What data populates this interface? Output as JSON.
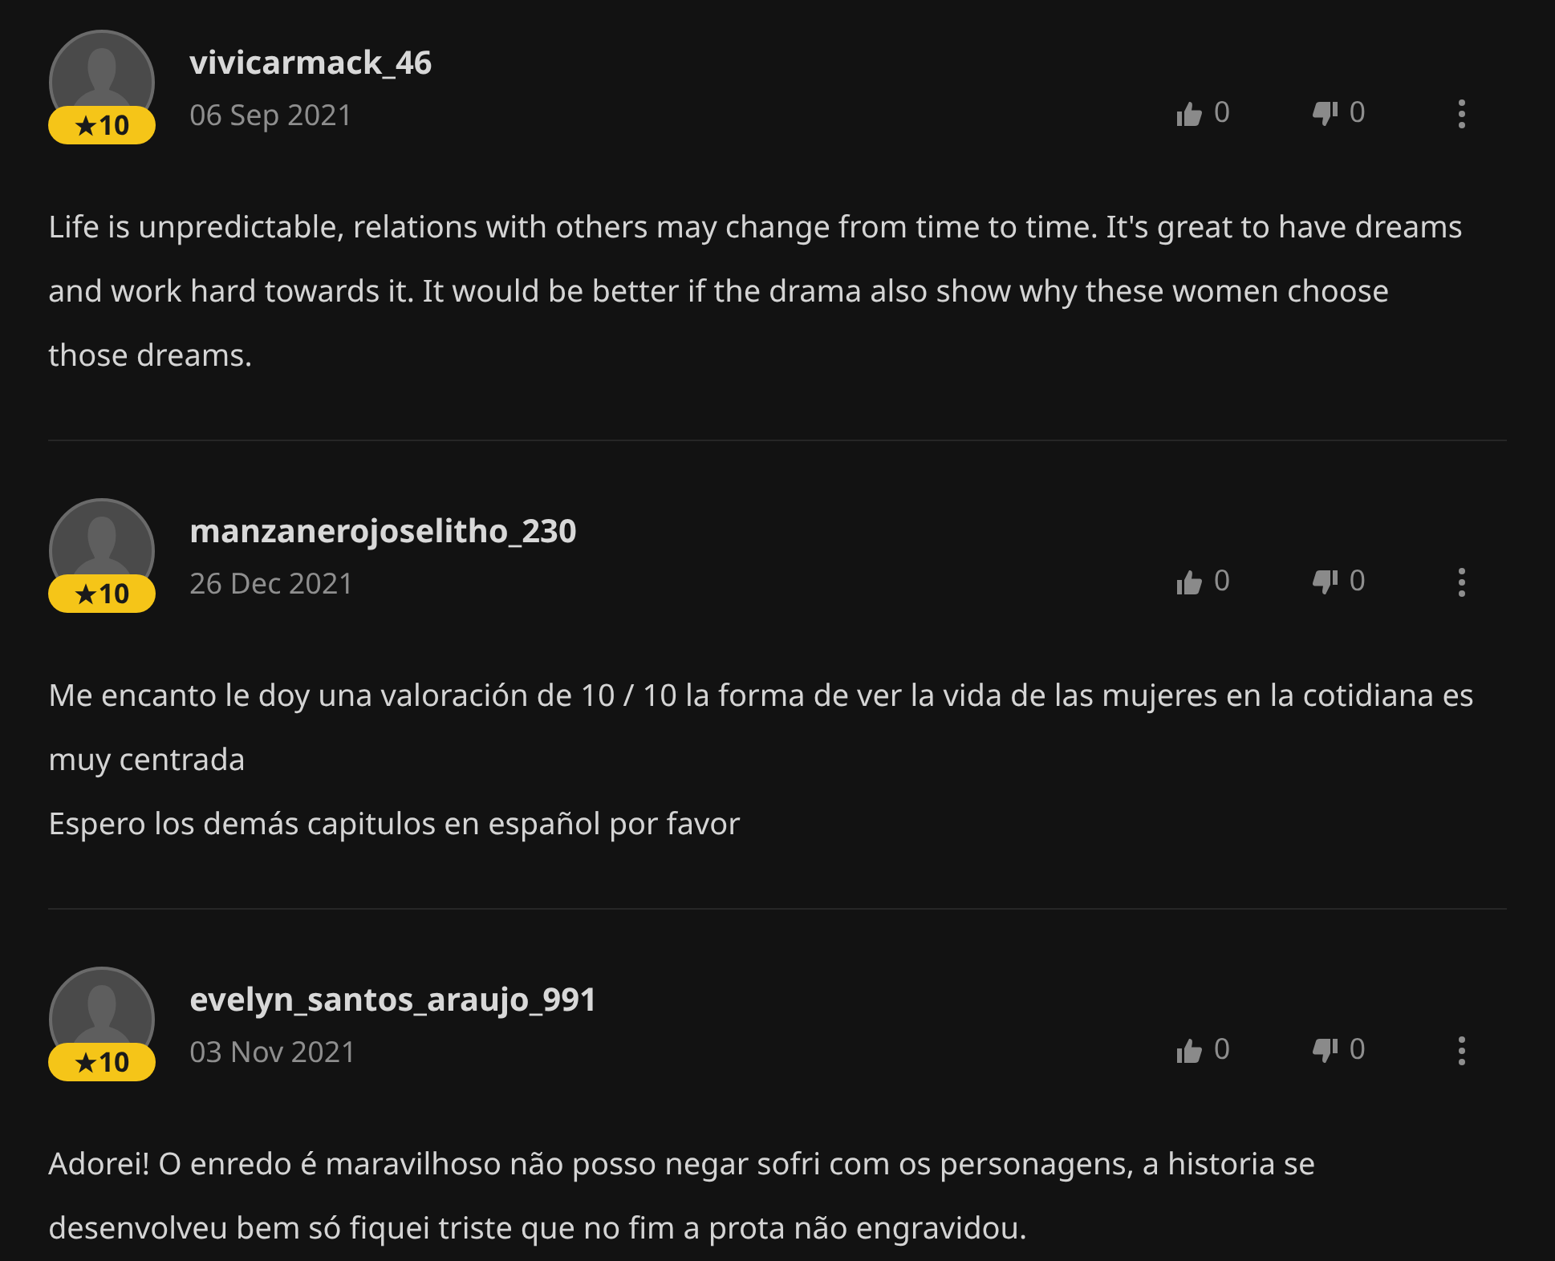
{
  "reviews": [
    {
      "username": "vivicarmack_46",
      "date": "06 Sep 2021",
      "rating": "10",
      "likes": "0",
      "dislikes": "0",
      "paragraphs": [
        "Life is unpredictable, relations with others may change from time to time. It's great to have dreams and work hard towards it. It would be better if the drama also show why these women choose those dreams."
      ]
    },
    {
      "username": "manzanerojoselitho_230",
      "date": "26 Dec 2021",
      "rating": "10",
      "likes": "0",
      "dislikes": "0",
      "paragraphs": [
        "Me encanto le doy una valoración de 10 / 10 la forma de ver la vida de las mujeres en la cotidiana es muy centrada",
        "Espero los demás capitulos en español por favor"
      ]
    },
    {
      "username": "evelyn_santos_araujo_991",
      "date": "03 Nov 2021",
      "rating": "10",
      "likes": "0",
      "dislikes": "0",
      "paragraphs": [
        "Adorei! O enredo é maravilhoso não posso negar sofri com os personagens, a historia se desenvolveu bem só fiquei triste que no fim a prota não engravidou."
      ]
    }
  ]
}
